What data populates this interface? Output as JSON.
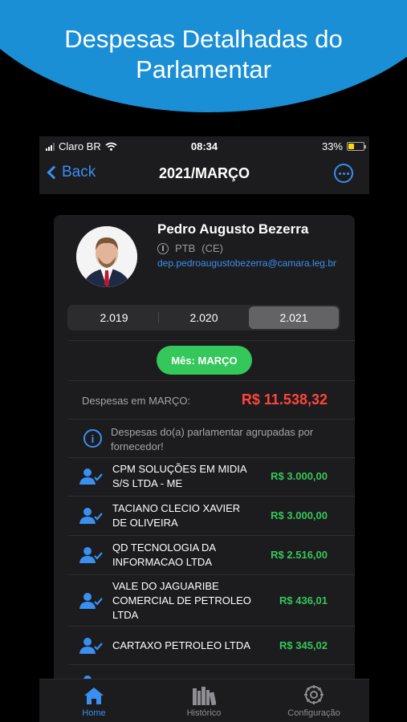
{
  "promo": {
    "line1": "Despesas Detalhadas do",
    "line2": "Parlamentar"
  },
  "status": {
    "carrier": "Claro BR",
    "time": "08:34",
    "battery": "33%",
    "battery_level": 0.33
  },
  "nav": {
    "back_label": "Back",
    "title": "2021/MARÇO",
    "more_icon": "ellipsis-circle-icon"
  },
  "profile": {
    "name": "Pedro Augusto Bezerra",
    "party": "PTB",
    "state": "(CE)",
    "email": "dep.pedroaugustobezerra@camara.leg.br"
  },
  "years": [
    "2.019",
    "2.020",
    "2.021"
  ],
  "selected_year": "2.021",
  "month_button": "Mês: MARÇO",
  "total": {
    "label": "Despesas em MARÇO:",
    "value": "R$ 11.538,32"
  },
  "info": "Despesas do(a) parlamentar agrupadas por fornecedor!",
  "suppliers": [
    {
      "name": "CPM SOLUÇÕES EM MIDIA S/S LTDA - ME",
      "amount": "R$ 3.000,00"
    },
    {
      "name": "TACIANO CLECIO XAVIER DE OLIVEIRA",
      "amount": "R$ 3.000,00"
    },
    {
      "name": "QD TECNOLOGIA DA INFORMACAO LTDA",
      "amount": "R$ 2.516,00"
    },
    {
      "name": "VALE DO JAGUARIBE COMERCIAL DE PETROLEO LTDA",
      "amount": "R$ 436,01"
    },
    {
      "name": "CARTAXO PETROLEO LTDA",
      "amount": "R$ 345,02"
    }
  ],
  "tabs": [
    {
      "label": "Home",
      "icon": "home-icon",
      "active": true
    },
    {
      "label": "Histórico",
      "icon": "books-icon",
      "active": false
    },
    {
      "label": "Configuração",
      "icon": "gear-icon",
      "active": false
    }
  ],
  "colors": {
    "accent": "#3a8ff0",
    "green": "#34c759",
    "red": "#ff453a",
    "promo": "#1a8fd6"
  }
}
